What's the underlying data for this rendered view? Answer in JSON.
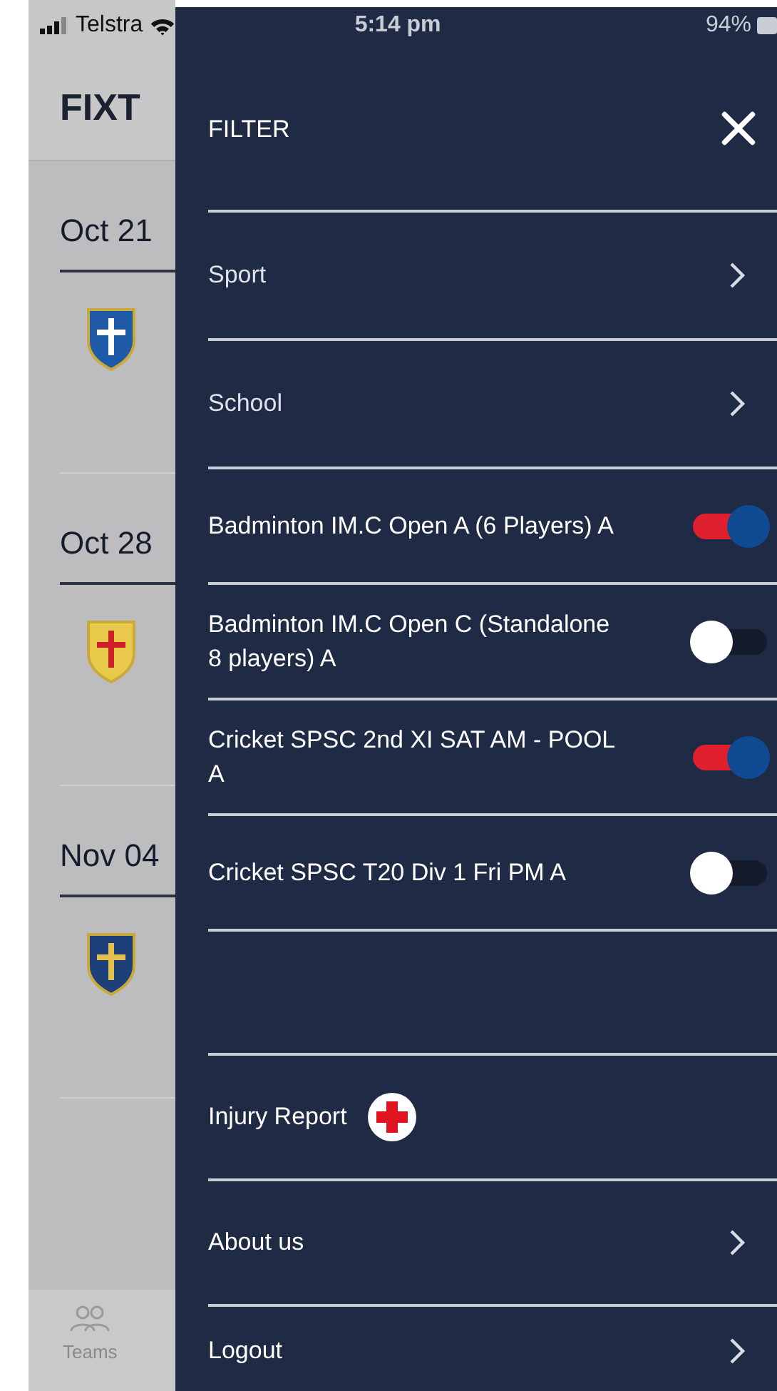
{
  "status_bar": {
    "carrier": "Telstra",
    "time": "5:14 pm",
    "battery": "94%"
  },
  "background": {
    "title": "FIXT",
    "fixtures": [
      {
        "date": "Oct 21"
      },
      {
        "date": "Oct 28"
      },
      {
        "date": "Nov 04"
      }
    ],
    "tab_bar": [
      {
        "label": "Teams"
      }
    ]
  },
  "drawer": {
    "title": "FILTER",
    "filters": [
      {
        "kind": "nav",
        "label": "Sport"
      },
      {
        "kind": "nav",
        "label": "School"
      },
      {
        "kind": "toggle",
        "label": "Badminton IM.C Open A (6 Players) A",
        "on": true
      },
      {
        "kind": "toggle",
        "label": "Badminton IM.C Open C (Standalone 8 players) A",
        "on": false
      },
      {
        "kind": "toggle",
        "label": "Cricket SPSC 2nd XI SAT AM - POOL A",
        "on": true
      },
      {
        "kind": "toggle",
        "label": "Cricket SPSC T20 Div 1 Fri PM A",
        "on": false
      }
    ],
    "menu": [
      {
        "kind": "report",
        "label": "Injury Report"
      },
      {
        "kind": "nav",
        "label": "About us"
      },
      {
        "kind": "nav",
        "label": "Logout"
      }
    ]
  }
}
